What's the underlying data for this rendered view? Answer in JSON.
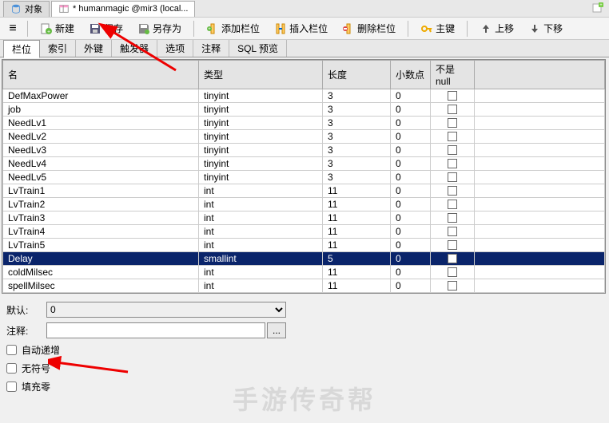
{
  "tabs": {
    "obj": "对象",
    "file": "* humanmagic @mir3 (local..."
  },
  "toolbar": {
    "new": "新建",
    "save": "保存",
    "saveas": "另存为",
    "addcol": "添加栏位",
    "inscol": "插入栏位",
    "delcol": "删除栏位",
    "pkey": "主键",
    "moveup": "上移",
    "movedown": "下移"
  },
  "subtabs": [
    "栏位",
    "索引",
    "外键",
    "触发器",
    "选项",
    "注释",
    "SQL 预览"
  ],
  "grid": {
    "headers": {
      "name": "名",
      "type": "类型",
      "len": "长度",
      "dec": "小数点",
      "null": "不是 null"
    },
    "rows": [
      {
        "name": "DefMaxPower",
        "type": "tinyint",
        "len": "3",
        "dec": "0",
        "sel": false
      },
      {
        "name": "job",
        "type": "tinyint",
        "len": "3",
        "dec": "0",
        "sel": false
      },
      {
        "name": "NeedLv1",
        "type": "tinyint",
        "len": "3",
        "dec": "0",
        "sel": false
      },
      {
        "name": "NeedLv2",
        "type": "tinyint",
        "len": "3",
        "dec": "0",
        "sel": false
      },
      {
        "name": "NeedLv3",
        "type": "tinyint",
        "len": "3",
        "dec": "0",
        "sel": false
      },
      {
        "name": "NeedLv4",
        "type": "tinyint",
        "len": "3",
        "dec": "0",
        "sel": false
      },
      {
        "name": "NeedLv5",
        "type": "tinyint",
        "len": "3",
        "dec": "0",
        "sel": false
      },
      {
        "name": "LvTrain1",
        "type": "int",
        "len": "11",
        "dec": "0",
        "sel": false
      },
      {
        "name": "LvTrain2",
        "type": "int",
        "len": "11",
        "dec": "0",
        "sel": false
      },
      {
        "name": "LvTrain3",
        "type": "int",
        "len": "11",
        "dec": "0",
        "sel": false
      },
      {
        "name": "LvTrain4",
        "type": "int",
        "len": "11",
        "dec": "0",
        "sel": false
      },
      {
        "name": "LvTrain5",
        "type": "int",
        "len": "11",
        "dec": "0",
        "sel": false
      },
      {
        "name": "Delay",
        "type": "smallint",
        "len": "5",
        "dec": "0",
        "sel": true
      },
      {
        "name": "coldMilsec",
        "type": "int",
        "len": "11",
        "dec": "0",
        "sel": false
      },
      {
        "name": "spellMilsec",
        "type": "int",
        "len": "11",
        "dec": "0",
        "sel": false
      }
    ]
  },
  "props": {
    "default_label": "默认:",
    "default_value": "0",
    "comment_label": "注释:",
    "comment_value": "",
    "auto_incr": "自动递增",
    "unsigned": "无符号",
    "zerofill": "填充零"
  },
  "watermark": "手游传奇帮"
}
